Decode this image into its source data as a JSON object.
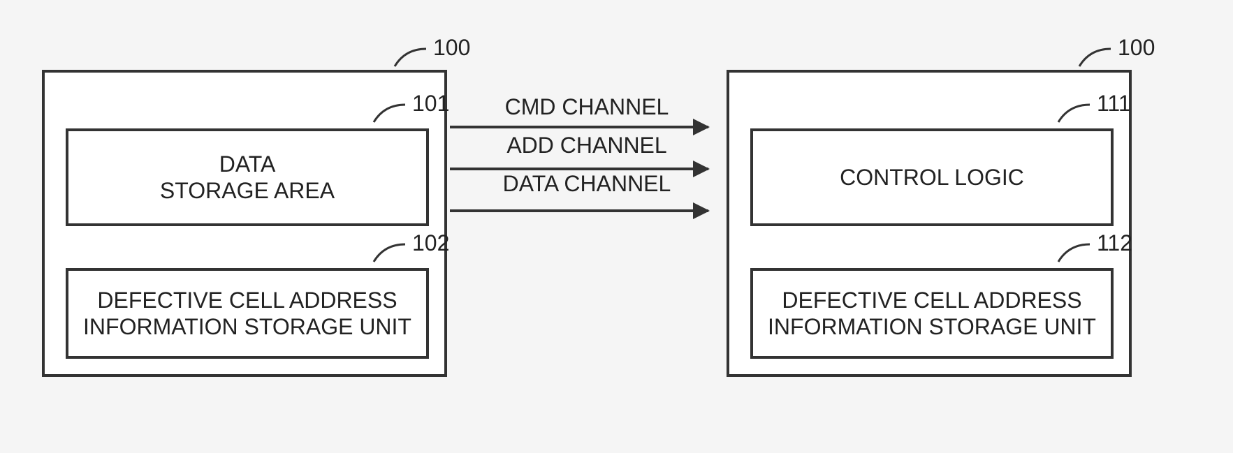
{
  "diagram": {
    "left_block": {
      "ref": "100",
      "upper_box": {
        "ref": "101",
        "line1": "DATA",
        "line2": "STORAGE AREA"
      },
      "lower_box": {
        "ref": "102",
        "line1": "DEFECTIVE CELL ADDRESS",
        "line2": "INFORMATION STORAGE UNIT"
      }
    },
    "right_block": {
      "ref": "100",
      "upper_box": {
        "ref": "111",
        "text": "CONTROL LOGIC"
      },
      "lower_box": {
        "ref": "112",
        "line1": "DEFECTIVE CELL ADDRESS",
        "line2": "INFORMATION STORAGE UNIT"
      }
    },
    "channels": {
      "cmd": "CMD CHANNEL",
      "add": "ADD CHANNEL",
      "data": "DATA CHANNEL"
    }
  }
}
